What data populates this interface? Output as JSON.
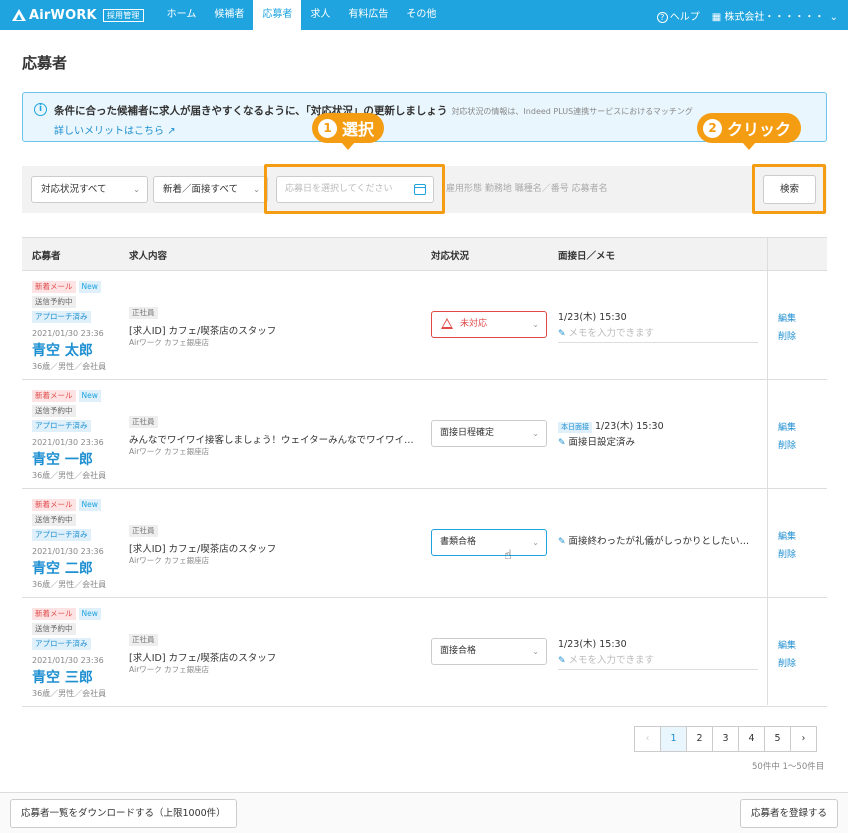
{
  "app": {
    "logo_text": "AirWORK",
    "logo_badge": "採用管理"
  },
  "nav": {
    "items": [
      "ホーム",
      "候補者",
      "応募者",
      "求人",
      "有料広告",
      "その他"
    ],
    "help": "ヘルプ",
    "company": "株式会社・・・・・・"
  },
  "page": {
    "title": "応募者"
  },
  "banner": {
    "text": "条件に合った候補者に求人が届きやすくなるように、「対応状況」の更新しましょう",
    "sub": "対応状況の情報は、Indeed PLUS連携サービスにおけるマッチング",
    "link": "詳しいメリットはこちら"
  },
  "callouts": [
    {
      "num": "1",
      "label": "選択"
    },
    {
      "num": "2",
      "label": "クリック"
    }
  ],
  "search": {
    "status_select": "対応状況すべて",
    "new_select": "新着／面接すべて",
    "date_placeholder": "応募日を選択してください",
    "keyword_placeholder": "雇用形態  勤務地  職種名／番号  応募者名",
    "button": "検索"
  },
  "table": {
    "headers": [
      "応募者",
      "求人内容",
      "対応状況",
      "面接日／メモ"
    ],
    "rows": [
      {
        "badge_mail": "新着メール",
        "badge_new": "New",
        "badge_scheduled": "送信予約中",
        "badge_approach": "アプローチ済み",
        "datetime": "2021/01/30 23:36",
        "name": "青空 太郎",
        "profile": "36歳／男性／会社員",
        "job_type": "正社員",
        "job_title": "[求人ID] カフェ/喫茶店のスタッフ",
        "store": "Airワーク カフェ銀座店",
        "status": "未対応",
        "interview": "1/23(木) 15:30",
        "memo": "メモを入力できます",
        "edit": "編集",
        "delete": "削除"
      },
      {
        "badge_mail": "新着メール",
        "badge_new": "New",
        "badge_scheduled": "送信予約中",
        "badge_approach": "アプローチ済み",
        "datetime": "2021/01/30 23:36",
        "name": "青空 一郎",
        "profile": "36歳／男性／会社員",
        "job_type": "正社員",
        "job_title": "みんなでワイワイ接客しましょう！ウェイターみんなでワイワイ接…",
        "store": "Airワーク カフェ銀座店",
        "status": "面接日程確定",
        "today": "本日面接",
        "interview": "1/23(木) 15:30",
        "memo": "面接日設定済み",
        "edit": "編集",
        "delete": "削除"
      },
      {
        "badge_mail": "新着メール",
        "badge_new": "New",
        "badge_scheduled": "送信予約中",
        "badge_approach": "アプローチ済み",
        "datetime": "2021/01/30 23:36",
        "name": "青空 二郎",
        "profile": "36歳／男性／会社員",
        "job_type": "正社員",
        "job_title": "[求人ID] カフェ/喫茶店のスタッフ",
        "store": "Airワーク カフェ銀座店",
        "status": "書類合格",
        "memo": "面接終わったが礼儀がしっかりとしたいい…",
        "edit": "編集",
        "delete": "削除"
      },
      {
        "badge_mail": "新着メール",
        "badge_new": "New",
        "badge_scheduled": "送信予約中",
        "badge_approach": "アプローチ済み",
        "datetime": "2021/01/30 23:36",
        "name": "青空 三郎",
        "profile": "36歳／男性／会社員",
        "job_type": "正社員",
        "job_title": "[求人ID] カフェ/喫茶店のスタッフ",
        "store": "Airワーク カフェ銀座店",
        "status": "面接合格",
        "interview": "1/23(木) 15:30",
        "memo": "メモを入力できます",
        "edit": "編集",
        "delete": "削除"
      }
    ]
  },
  "pagination": {
    "prev": "‹",
    "next": "›",
    "pages": [
      "1",
      "2",
      "3",
      "4",
      "5"
    ],
    "current": "1",
    "summary": "50件中 1〜50件目"
  },
  "footer": {
    "download": "応募者一覧をダウンロードする（上限1000件）",
    "register": "応募者を登録する"
  },
  "colors": {
    "brand": "#1fa4e0",
    "callout": "#f59d12",
    "alert": "#e04848"
  }
}
